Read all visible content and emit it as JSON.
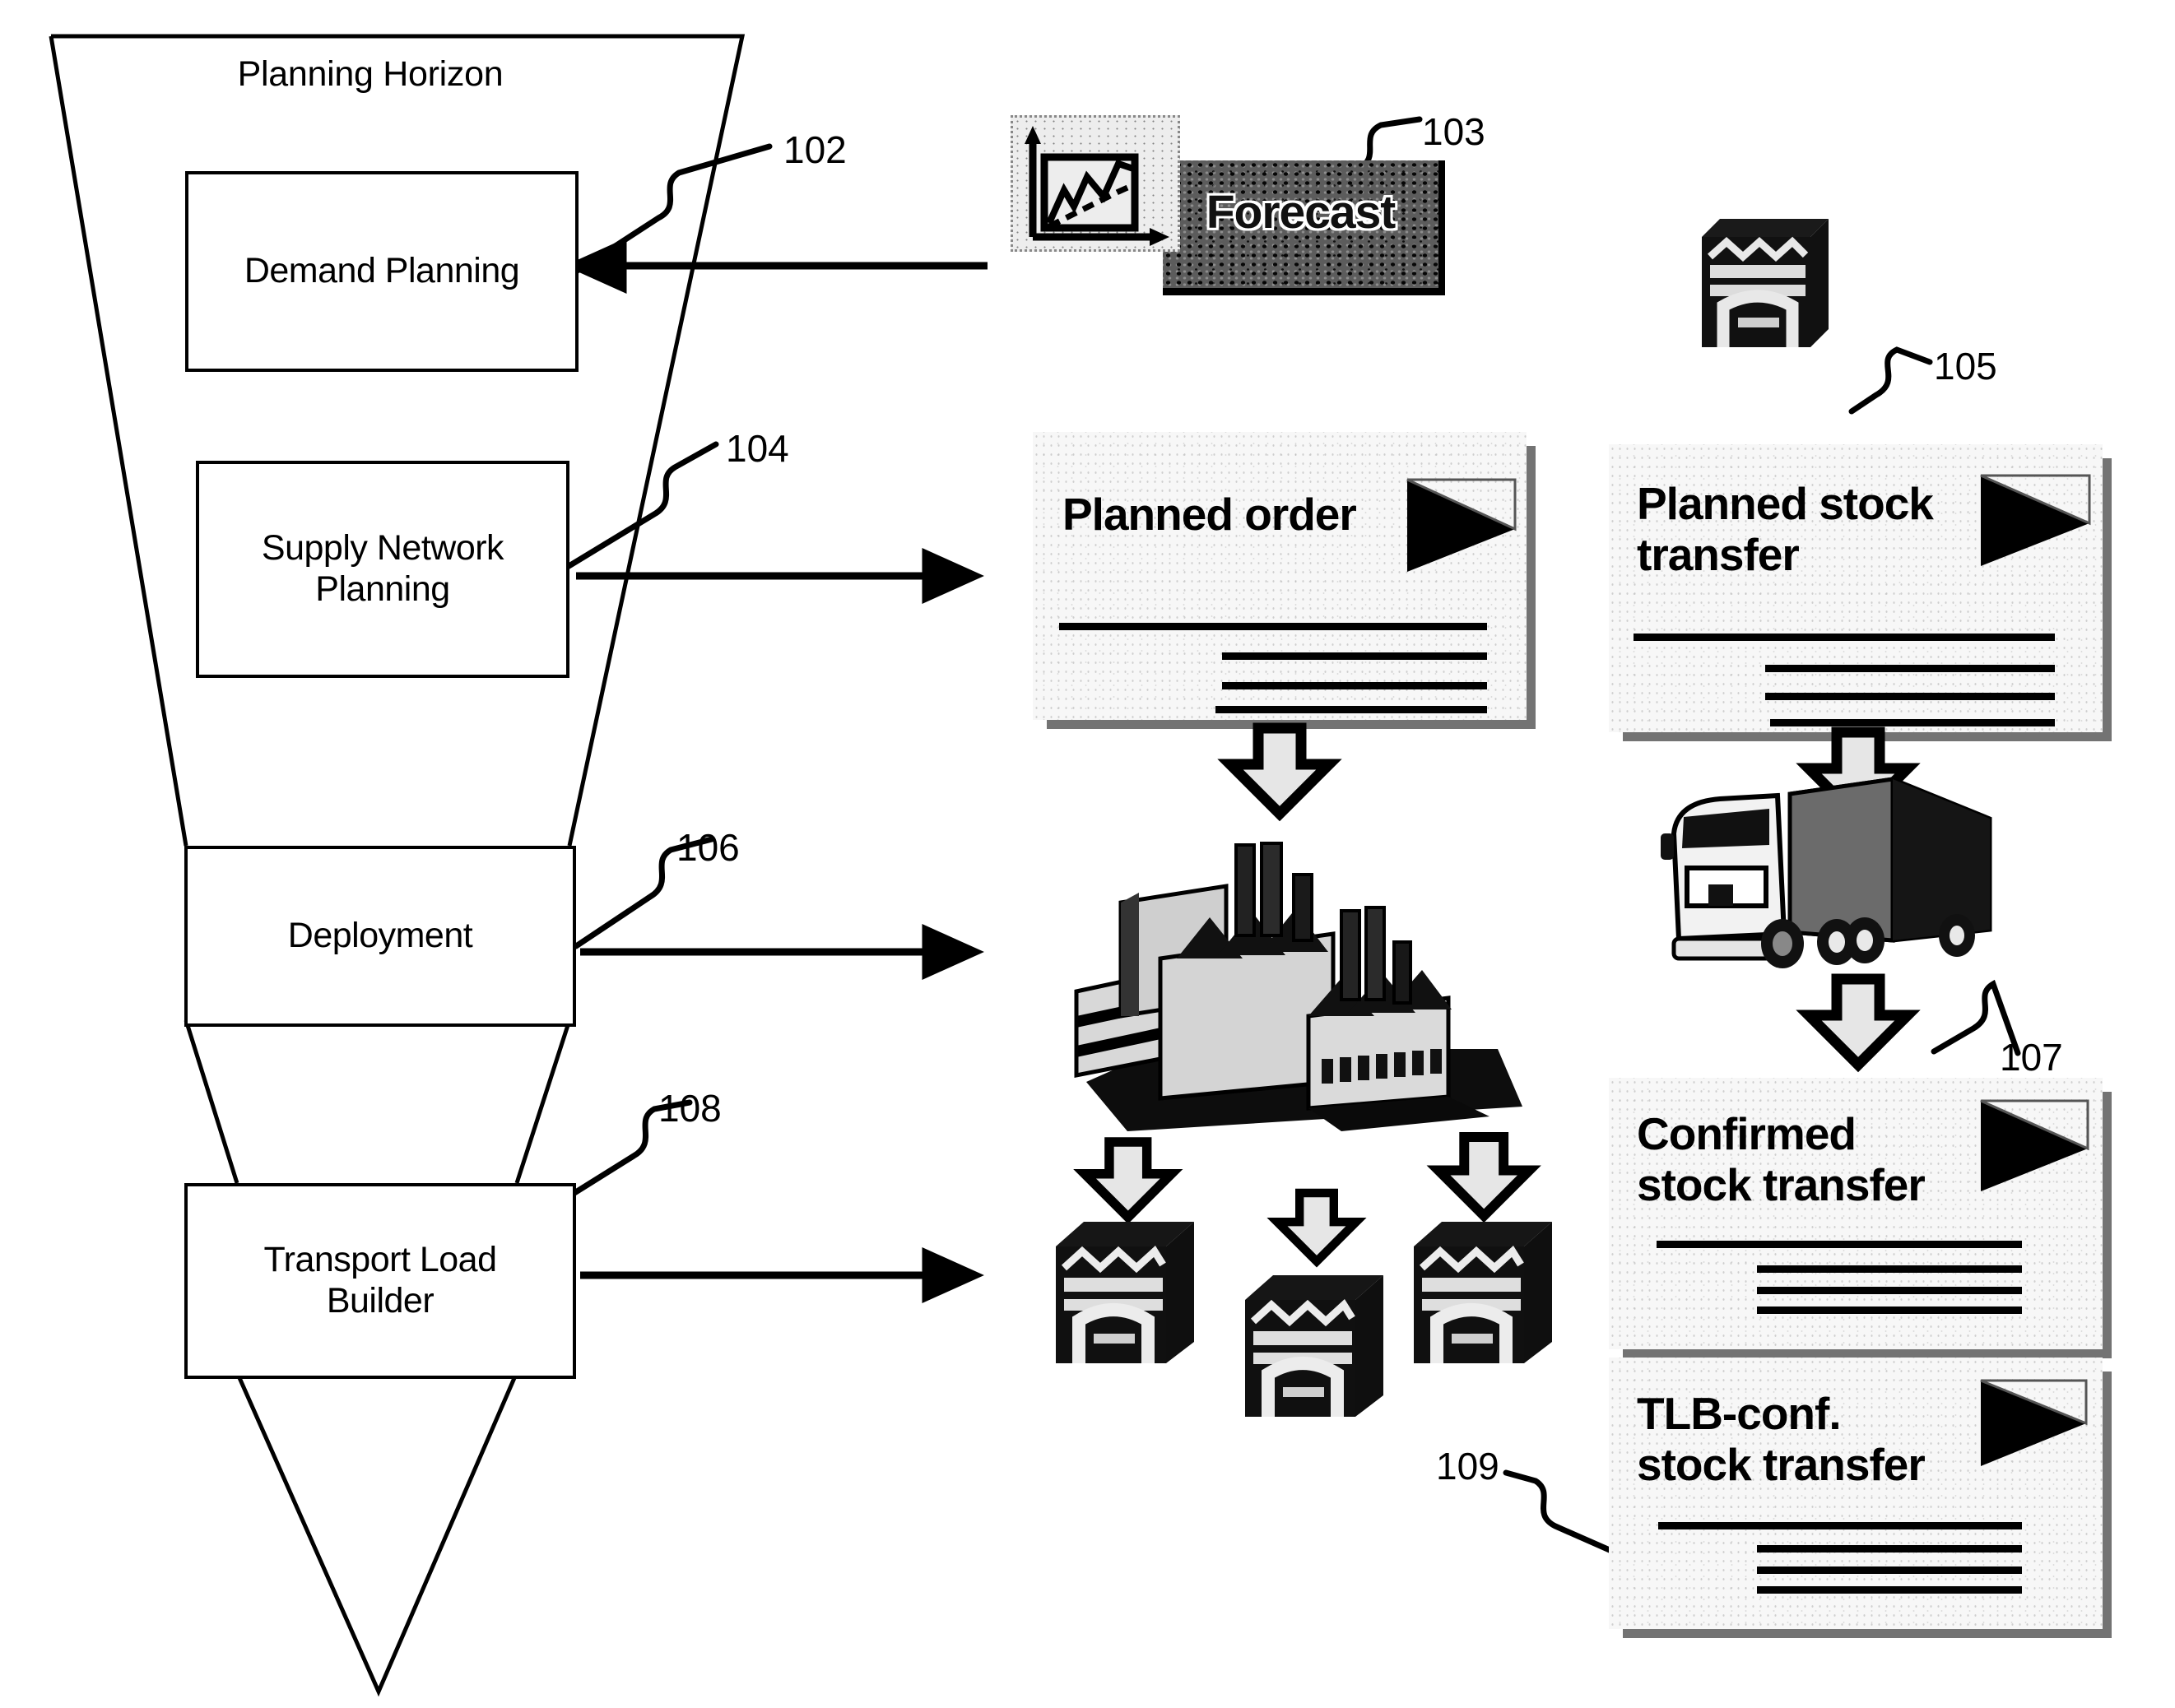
{
  "diagram": {
    "title": "Supply chain planning horizon flow diagram",
    "funnel_label": "Planning Horizon",
    "stages": [
      {
        "id": "demand-planning",
        "label": "Demand Planning",
        "ref": "102"
      },
      {
        "id": "supply-network-planning",
        "label": "Supply Network\nPlanning",
        "ref": "104"
      },
      {
        "id": "deployment",
        "label": "Deployment",
        "ref": "106"
      },
      {
        "id": "transport-load-builder",
        "label": "Transport Load\nBuilder",
        "ref": "108"
      }
    ],
    "stage_labels": {
      "demand_planning": "Demand Planning",
      "supply_network_planning_line1": "Supply Network",
      "supply_network_planning_line2": "Planning",
      "deployment": "Deployment",
      "transport_load_builder_line1": "Transport Load",
      "transport_load_builder_line2": "Builder"
    },
    "ref_numbers": {
      "demand_planning": "102",
      "forecast": "103",
      "supply_network_planning": "104",
      "planned_stock_transfer": "105",
      "deployment": "106",
      "confirmed_stock_transfer": "107",
      "transport_load_builder": "108",
      "tlb_confirmed_stock_transfer": "109"
    },
    "artifacts": {
      "forecast": {
        "label": "Forecast",
        "ref": "103",
        "kind": "forecast-banner"
      },
      "planned_order": {
        "title": "Planned order",
        "ref": "",
        "kind": "document"
      },
      "planned_stock_transfer": {
        "title_line1": "Planned stock",
        "title_line2": "transfer",
        "ref": "105",
        "kind": "document"
      },
      "confirmed_stock_transfer": {
        "title_line1": "Confirmed",
        "title_line2": "stock transfer",
        "ref": "107",
        "kind": "document"
      },
      "tlb_confirmed_stock_transfer": {
        "title_line1": "TLB-conf.",
        "title_line2": "stock transfer",
        "ref": "109",
        "kind": "document"
      }
    },
    "icons": [
      {
        "name": "line-chart-icon",
        "description": "Trend chart with rising line"
      },
      {
        "name": "warehouse-icon",
        "description": "Distribution center building"
      },
      {
        "name": "factory-icon",
        "description": "Factory plant with smokestacks"
      },
      {
        "name": "truck-icon",
        "description": "Semi truck with trailer"
      },
      {
        "name": "down-block-arrow-icon",
        "description": "Downward 3D block arrow"
      },
      {
        "name": "right-arrow-icon",
        "description": "Rightward line arrow"
      }
    ],
    "colors": {
      "stroke": "#000000",
      "paper": "#ffffff",
      "document_fill": "#f7f7f7",
      "banner_fill": "#5c5c5c"
    }
  }
}
